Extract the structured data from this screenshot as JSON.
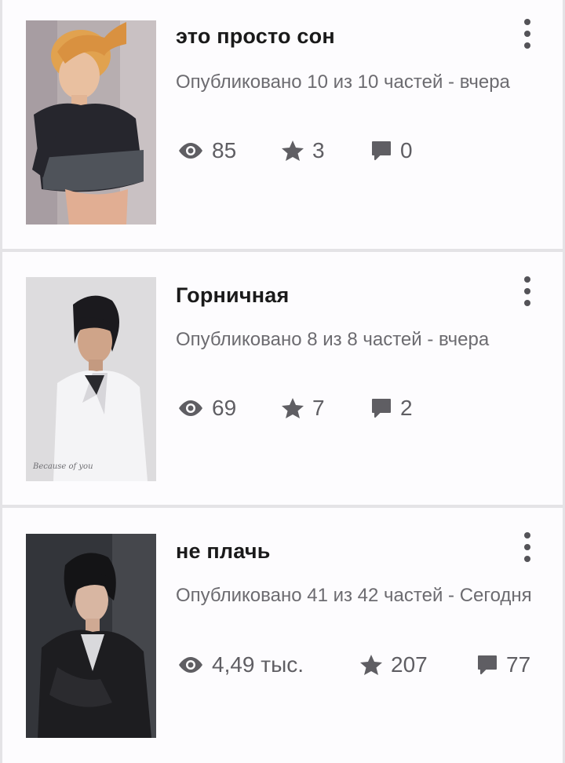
{
  "stories": [
    {
      "title": "это просто сон",
      "published": "Опубликовано 10 из 10 частей - вчера",
      "views": "85",
      "votes": "3",
      "comments": "0"
    },
    {
      "title": "Горничная",
      "published": "Опубликовано 8 из 8 частей - вчера",
      "cover_caption": "Because of you",
      "views": "69",
      "votes": "7",
      "comments": "2"
    },
    {
      "title": "не плачь",
      "published": "Опубликовано 41 из 42 частей - Сегодня",
      "views": "4,49 тыс.",
      "votes": "207",
      "comments": "77"
    }
  ],
  "icons": {
    "views": "eye-icon",
    "votes": "star-icon",
    "comments": "comment-icon",
    "menu": "more-vertical-icon"
  },
  "colors": {
    "title": "#1a1a1a",
    "meta": "#6c6b70",
    "stat": "#5f5e63",
    "separator": "#e4e3e6"
  }
}
